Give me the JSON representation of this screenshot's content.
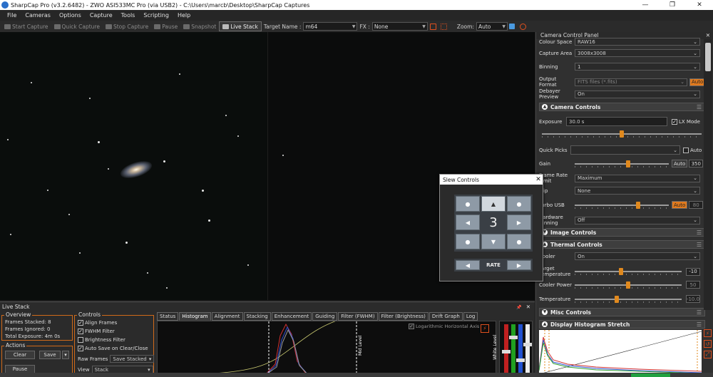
{
  "window": {
    "title": "SharpCap Pro (v3.2.6482) - ZWO ASI533MC Pro (via USB2) - C:\\Users\\marcb\\Desktop\\SharpCap Captures",
    "controls": [
      "—",
      "❐",
      "✕"
    ]
  },
  "menu": [
    "File",
    "Cameras",
    "Options",
    "Capture",
    "Tools",
    "Scripting",
    "Help"
  ],
  "toolbar": {
    "start_capture": "Start Capture",
    "quick_capture": "Quick Capture",
    "stop_capture": "Stop Capture",
    "pause": "Pause",
    "snapshot": "Snapshot",
    "live_stack": "Live Stack",
    "target_label": "Target Name :",
    "target_value": "m64",
    "fx_label": "FX :",
    "fx_value": "None",
    "zoom_label": "Zoom:",
    "zoom_value": "Auto"
  },
  "camera_panel": {
    "title": "Camera Control Panel",
    "colour_space_label": "Colour Space",
    "colour_space_value": "RAW16",
    "capture_area_label": "Capture Area",
    "capture_area_value": "3008x3008",
    "binning_label": "Binning",
    "binning_value": "1",
    "output_format_label": "Output Format",
    "output_format_value": "FITS files (*.fits)",
    "output_auto": "Auto",
    "debayer_label": "Debayer Preview",
    "debayer_value": "On",
    "camera_controls": "Camera Controls",
    "exposure_label": "Exposure",
    "exposure_value": "30.0 s",
    "lx_mode": "LX Mode",
    "quick_picks_label": "Quick Picks",
    "quick_picks_auto": "Auto",
    "gain_label": "Gain",
    "gain_auto": "Auto",
    "gain_value": "350",
    "frame_rate_label": "Frame Rate Limit",
    "frame_rate_value": "Maximum",
    "flip_label": "Flip",
    "flip_value": "None",
    "turbo_label": "Turbo USB",
    "turbo_auto": "Auto",
    "turbo_value": "80",
    "hardware_binning_label": "Hardware Binning",
    "hardware_binning_value": "Off",
    "image_controls": "Image Controls",
    "thermal_controls": "Thermal Controls",
    "cooler_label": "Cooler",
    "cooler_value": "On",
    "target_temp_label": "Target Temperature",
    "target_temp_value": "-10",
    "cooler_power_label": "Cooler Power",
    "cooler_power_value": "50",
    "temperature_label": "Temperature",
    "temperature_value": "-10.0",
    "misc_controls": "Misc Controls",
    "display_histogram": "Display Histogram Stretch"
  },
  "slew": {
    "title": "Slew Controls",
    "close": "✕",
    "rate": "3",
    "rate_label": "RATE",
    "up": "▲",
    "down": "▼",
    "left": "◀",
    "right": "▶",
    "dot": "●"
  },
  "live_stack": {
    "title": "Live Stack",
    "overview": "Overview",
    "frames_stacked_label": "Frames Stacked:",
    "frames_stacked": "8",
    "frames_ignored_label": "Frames Ignored:",
    "frames_ignored": "0",
    "total_exposure_label": "Total Exposure:",
    "total_exposure": "4m 0s",
    "actions": "Actions",
    "clear": "Clear",
    "save": "Save",
    "pause": "Pause",
    "controls": "Controls",
    "align_frames": "Align Frames",
    "fwhm_filter": "FWHM Filter",
    "brightness_filter": "Brightness Filter",
    "auto_save": "Auto Save on Clear/Close",
    "raw_frames_label": "Raw Frames",
    "raw_frames_value": "Save Stacked",
    "view_label": "View",
    "view_value": "Stack",
    "tabs": [
      "Status",
      "Histogram",
      "Alignment",
      "Stacking",
      "Enhancement",
      "Guiding",
      "Filter (FWHM)",
      "Filter (Brightness)",
      "Drift Graph",
      "Log"
    ],
    "log_axis": "Logarithmic Horizontal Axis",
    "mid_level": "Mid Level",
    "white_level": "White Level",
    "pin": "📌",
    "close": "✕"
  }
}
